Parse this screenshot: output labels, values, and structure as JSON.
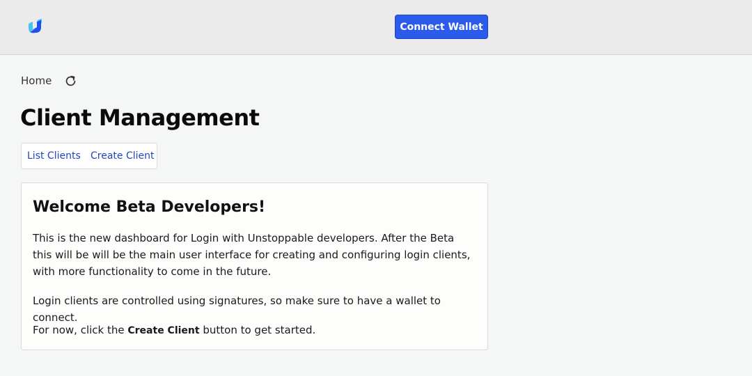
{
  "header": {
    "logo_icon": "unstoppable-logo-icon",
    "connect_label": "Connect Wallet",
    "accent_color": "#2a5bed"
  },
  "breadcrumb": {
    "home_label": "Home",
    "refresh_icon": "refresh-icon"
  },
  "page": {
    "title": "Client Management",
    "tabs": [
      {
        "label": "List Clients"
      },
      {
        "label": "Create Client"
      }
    ]
  },
  "welcome_card": {
    "heading": "Welcome Beta Developers!",
    "paragraph_1": "This is the new dashboard for Login with Unstoppable developers. After the Beta this will be will be the main user interface for creating and configuring login clients, with more functionality to come in the future.",
    "paragraph_2": "Login clients are controlled using signatures, so make sure to have a wallet to connect.",
    "paragraph_3_before": "For now, click the ",
    "paragraph_3_strong": "Create Client",
    "paragraph_3_after": " button to get started."
  }
}
